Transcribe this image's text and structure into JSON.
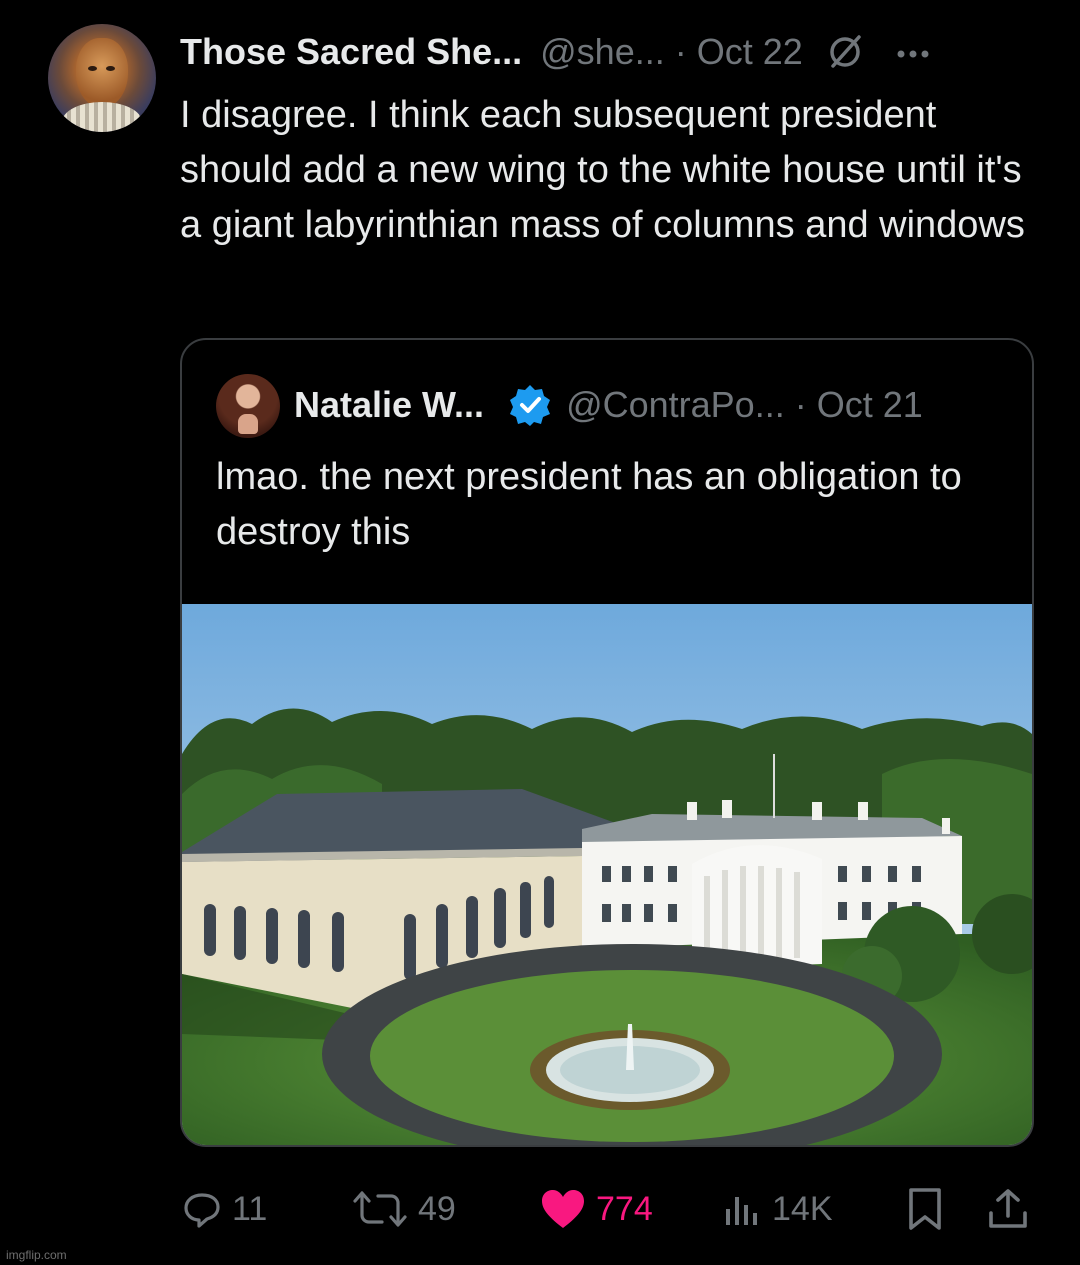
{
  "tweet": {
    "author_name": "Those Sacred She...",
    "author_handle": "@she...",
    "separator": "·",
    "date": "Oct 22",
    "text": "I disagree. I think each subsequent president should add a new wing to the white house until it's a giant labyrinthian mass of columns and windows"
  },
  "quoted_tweet": {
    "author_name": "Natalie W...",
    "author_handle": "@ContraPo...",
    "separator": "·",
    "date": "Oct 21",
    "verified": true,
    "text": "lmao. the next president has an obligation to destroy this"
  },
  "actions": {
    "replies": "11",
    "reposts": "49",
    "likes": "774",
    "views": "14K"
  },
  "icons": [
    "no-entry-icon",
    "more-icon",
    "verified-badge-icon",
    "reply-icon",
    "repost-icon",
    "heart-icon",
    "views-icon",
    "bookmark-icon",
    "share-icon"
  ],
  "colors": {
    "background": "#000000",
    "text": "#e7e9ea",
    "muted": "#71767b",
    "like": "#f91880",
    "verified": "#1d9bf0"
  },
  "watermark": "imgflip.com"
}
